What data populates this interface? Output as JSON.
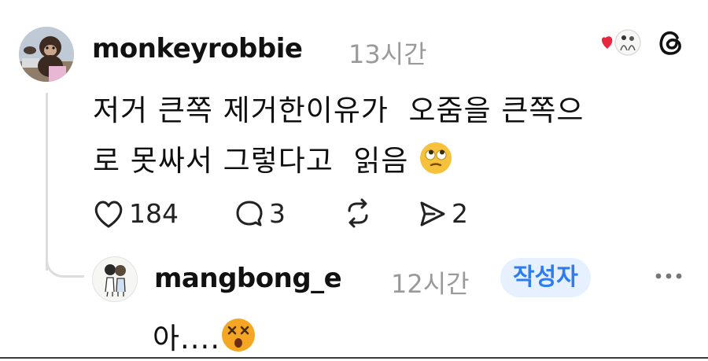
{
  "post": {
    "username": "monkeyrobbie",
    "time": "13시간",
    "text_line1": "저거 큰쪽 제거한이유가  오줌을 큰쪽으",
    "text_line2": "로 못싸서 그렇다고  읽음",
    "emoji_icon": "face-with-rolling-eyes-icon",
    "like_count": "184",
    "reply_count": "3",
    "share_count": "2"
  },
  "reply": {
    "username": "mangbong_e",
    "time": "12시간",
    "author_badge": "작성자",
    "text": "아....",
    "emoji_icon": "dizzy-face-icon"
  },
  "colors": {
    "badge_bg": "#e6f0fe",
    "badge_text": "#2d7cf0",
    "heart": "#e8263d",
    "muted": "#9a9a9a"
  }
}
